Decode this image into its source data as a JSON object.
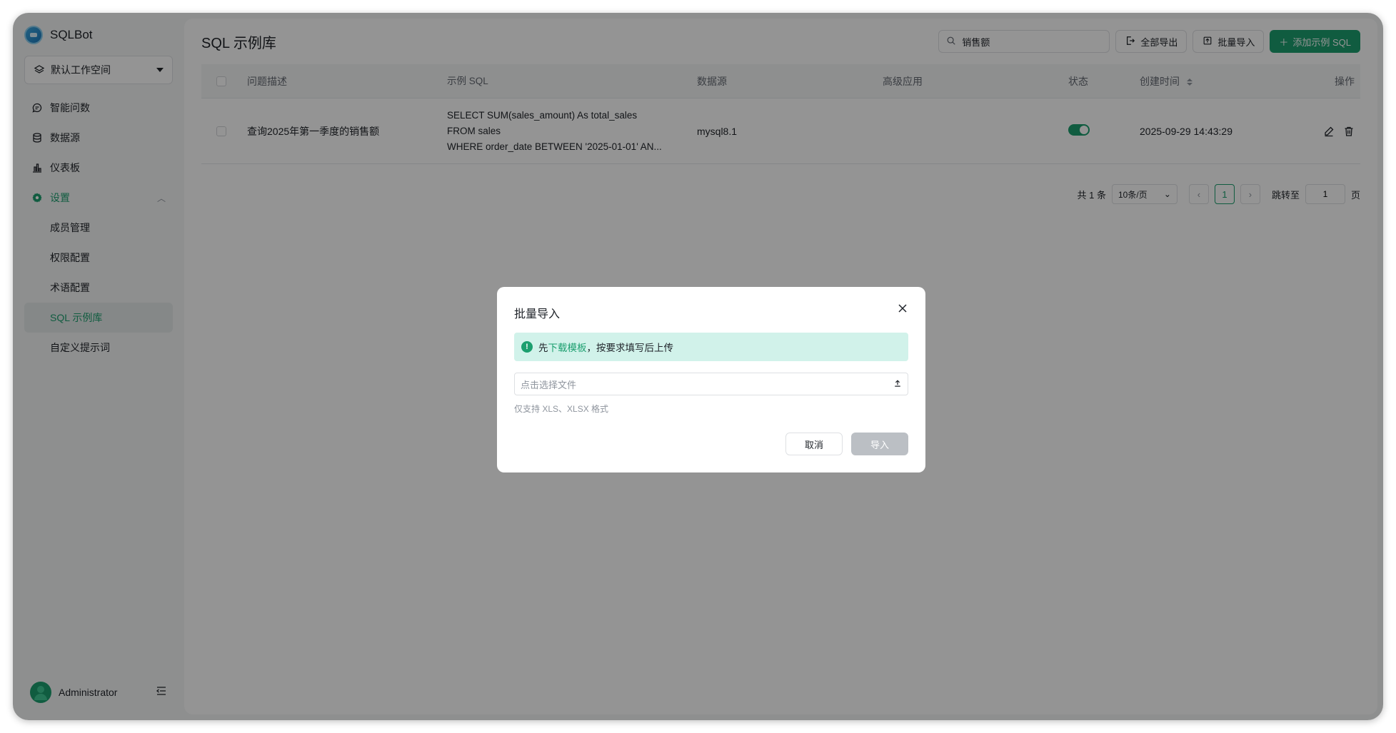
{
  "app": {
    "name": "SQLBot"
  },
  "workspace": {
    "label": "默认工作空间"
  },
  "nav": {
    "items": [
      {
        "label": "智能问数",
        "icon": "chat-icon"
      },
      {
        "label": "数据源",
        "icon": "database-icon"
      },
      {
        "label": "仪表板",
        "icon": "dashboard-icon"
      },
      {
        "label": "设置",
        "icon": "gear-icon"
      }
    ],
    "settings_sub": [
      {
        "label": "成员管理"
      },
      {
        "label": "权限配置"
      },
      {
        "label": "术语配置"
      },
      {
        "label": "SQL 示例库"
      },
      {
        "label": "自定义提示词"
      }
    ]
  },
  "user": {
    "name": "Administrator"
  },
  "page": {
    "title": "SQL 示例库"
  },
  "toolbar": {
    "search_value": "销售额",
    "export_all": "全部导出",
    "batch_import": "批量导入",
    "add_sql": "添加示例 SQL"
  },
  "table": {
    "headers": [
      "问题描述",
      "示例 SQL",
      "数据源",
      "高级应用",
      "状态",
      "创建时间",
      "操作"
    ],
    "rows": [
      {
        "question": "查询2025年第一季度的销售额",
        "sql_lines": [
          "SELECT SUM(sales_amount) As total_sales",
          "FROM sales",
          "WHERE order_date BETWEEN '2025-01-01' AN..."
        ],
        "datasource": "mysql8.1",
        "advanced": "",
        "status_on": true,
        "created": "2025-09-29 14:43:29"
      }
    ]
  },
  "pager": {
    "total": "共 1 条",
    "page_size": "10条/页",
    "current": "1",
    "jump_label": "跳转至",
    "jump_value": "1",
    "page_suffix": "页"
  },
  "modal": {
    "title": "批量导入",
    "alert_prefix": "先",
    "alert_link": "下载模板",
    "alert_suffix": "，按要求填写后上传",
    "file_placeholder": "点击选择文件",
    "hint": "仅支持 XLS、XLSX 格式",
    "cancel": "取消",
    "import": "导入"
  },
  "colors": {
    "accent": "#1c9f6f",
    "alert_bg": "#d1f2ea",
    "disabled_btn": "#bbbfc4"
  }
}
